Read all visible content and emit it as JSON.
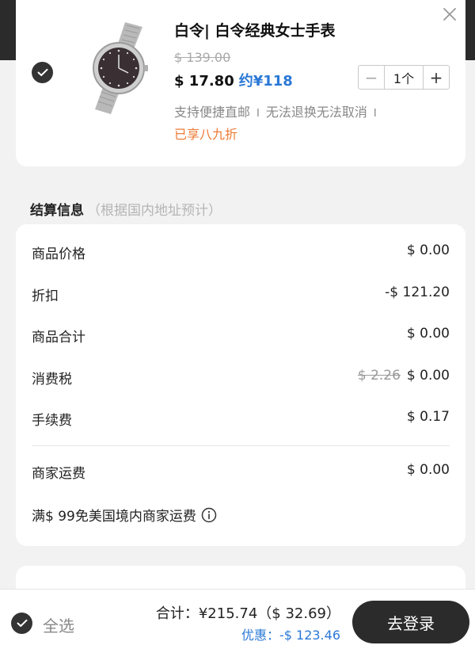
{
  "product": {
    "title": "白令| 白令经典女士手表",
    "original_price": "$ 139.00",
    "price": "$ 17.80",
    "approx_price": "约¥118",
    "quantity": "1个",
    "minus_label": "−",
    "plus_label": "+",
    "tags": [
      "支持便捷直邮",
      "无法退换无法取消"
    ],
    "tag_separator": "I",
    "discount": "已享八九折",
    "selected": true
  },
  "summary": {
    "heading": "结算信息",
    "subheading": "（根据国内地址预计）",
    "rows": [
      {
        "label": "商品价格",
        "value": "$ 0.00"
      },
      {
        "label": "折扣",
        "value": "-$ 121.20"
      },
      {
        "label": "商品合计",
        "value": "$ 0.00"
      },
      {
        "label": "消费税",
        "struck_value": "$ 2.26",
        "value": "$ 0.00"
      },
      {
        "label": "手续费",
        "value": "$ 0.17"
      },
      {
        "label": "商家运费",
        "value": "$ 0.00"
      }
    ],
    "free_shipping_note": "满$ 99免美国境内商家运费"
  },
  "bottom_bar": {
    "select_all": "全选",
    "total": "合计：¥215.74（$ 32.69）",
    "saving": "优惠：-$ 123.46",
    "login_button": "去登录"
  },
  "colors": {
    "accent_blue": "#2b78d6",
    "discount_orange": "#ef7a35",
    "dark": "#2b2b2b"
  },
  "icons": {
    "close": "close-icon",
    "check": "check-icon",
    "info": "info-icon"
  }
}
